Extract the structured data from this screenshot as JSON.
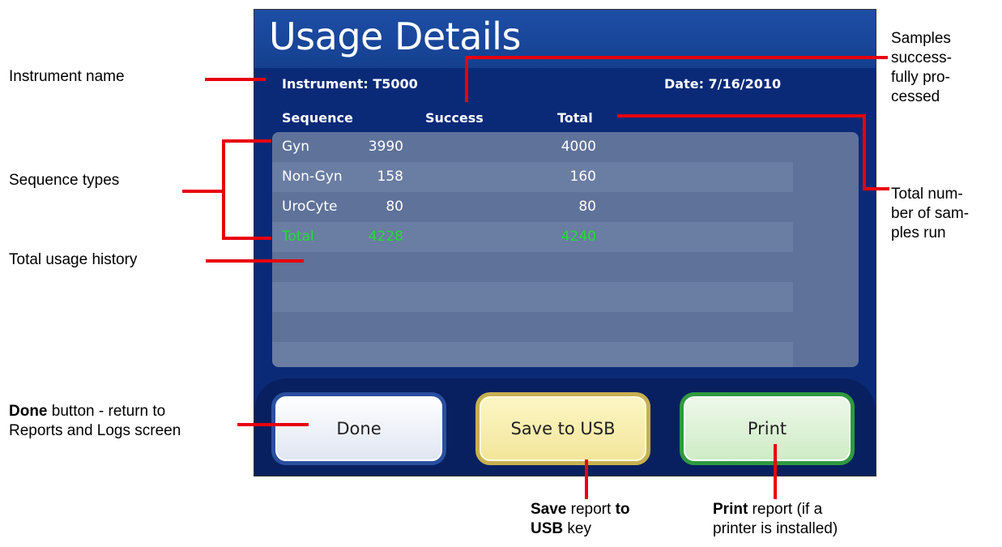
{
  "screen": {
    "title": "Usage Details",
    "instrument": "Instrument: T5000",
    "date": "Date: 7/16/2010",
    "columns": [
      "Sequence",
      "Success",
      "Total"
    ],
    "rows": [
      {
        "sequence": "Gyn",
        "success": "3990",
        "total": "4000"
      },
      {
        "sequence": "Non-Gyn",
        "success": "158",
        "total": "160"
      },
      {
        "sequence": "UroCyte",
        "success": "80",
        "total": "80"
      }
    ],
    "total_row": {
      "sequence": "Total",
      "success": "4228",
      "total": "4240"
    },
    "buttons": {
      "done": "Done",
      "save_usb": "Save to USB",
      "print": "Print"
    }
  },
  "callouts": {
    "instrument_name": "Instrument name",
    "sequence_types": "Sequence types",
    "total_usage": "Total usage history",
    "done_bold": "Done",
    "done_rest1": " button - return to",
    "done_rest2": "Reports and Logs screen",
    "samples_success": [
      "Samples",
      "success-",
      "fully pro-",
      "cessed"
    ],
    "total_samples": [
      "Total num-",
      "ber of sam-",
      "ples run"
    ],
    "save_bold1": "Save",
    "save_mid": " report ",
    "save_bold2": "to",
    "save_bold3": "USB",
    "save_end": " key",
    "print_bold": "Print",
    "print_rest1": " report (if a",
    "print_rest2": "printer is installed)"
  },
  "colors": {
    "callout_line": "#e8000b",
    "screen_bg": "#0a2a78",
    "total_row_text": "#22dd33"
  }
}
